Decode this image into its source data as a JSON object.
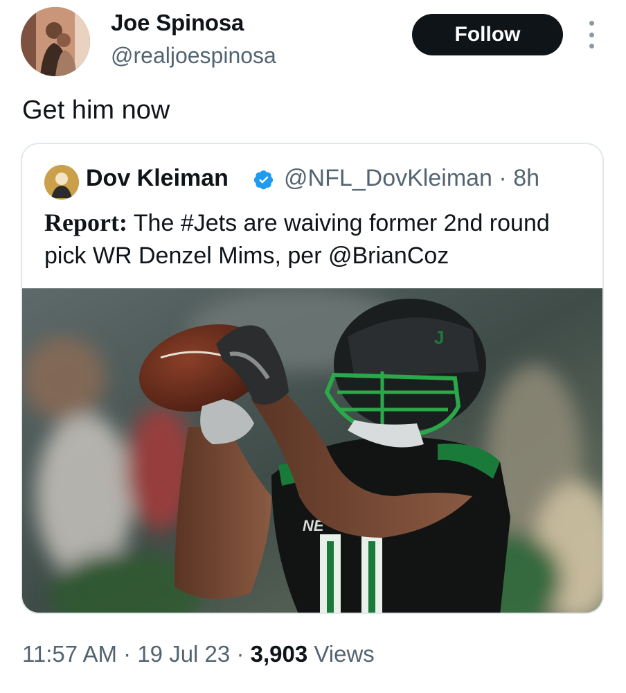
{
  "author": {
    "name": "Joe Spinosa",
    "handle": "@realjoespinosa",
    "follow_label": "Follow"
  },
  "tweet": {
    "text": "Get him now"
  },
  "quoted": {
    "name": "Dov Kleiman",
    "handle": "@NFL_DovKleiman",
    "separator": "·",
    "age": "8h",
    "report_label": "Report:",
    "text": " The #Jets are waiving former 2nd round pick WR Denzel Mims, per @BrianCoz",
    "image_alt": "Jets player catching a football"
  },
  "meta": {
    "time": "11:57 AM",
    "dot": "·",
    "date": "19 Jul 23",
    "views_count": "3,903",
    "views_label": "Views"
  },
  "colors": {
    "primary_text": "#0f1419",
    "secondary_text": "#536471",
    "verified": "#1d9bf0",
    "jets_green": "#1a7a3a"
  }
}
